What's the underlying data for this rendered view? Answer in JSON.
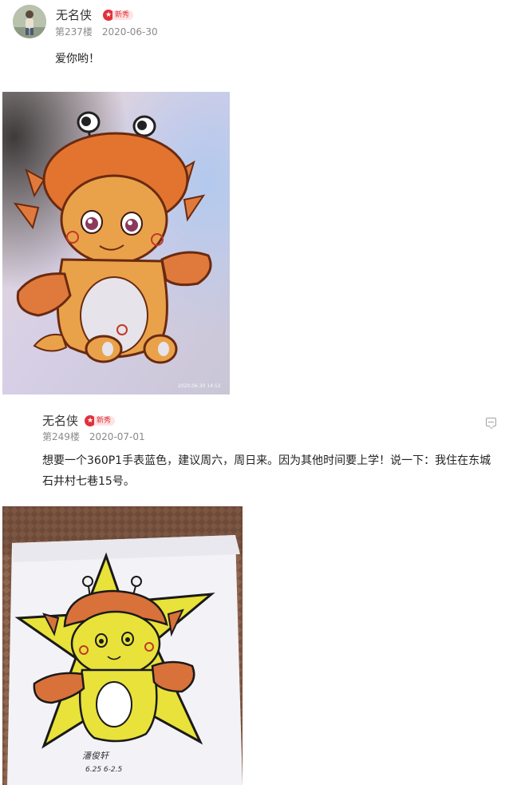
{
  "posts": [
    {
      "username": "无名侠",
      "badge": "新秀",
      "floor": "第237楼",
      "date": "2020-06-30",
      "content": "爱你哟！",
      "photo_timestamp": "2020.06.30 14:12"
    },
    {
      "username": "无名侠",
      "badge": "新秀",
      "floor": "第249楼",
      "date": "2020-07-01",
      "content": "想要一个360P1手表蓝色，建议周六，周日来。因为其他时间要上学！说一下：我住在东城石井村七巷15号。",
      "photo_signature": "潘俊轩",
      "photo_note": "6.25  6-2.5"
    }
  ],
  "colors": {
    "badge_red": "#e0323b",
    "meta_gray": "#8a8a8a"
  },
  "icons": [
    "star-icon",
    "reply-icon"
  ]
}
